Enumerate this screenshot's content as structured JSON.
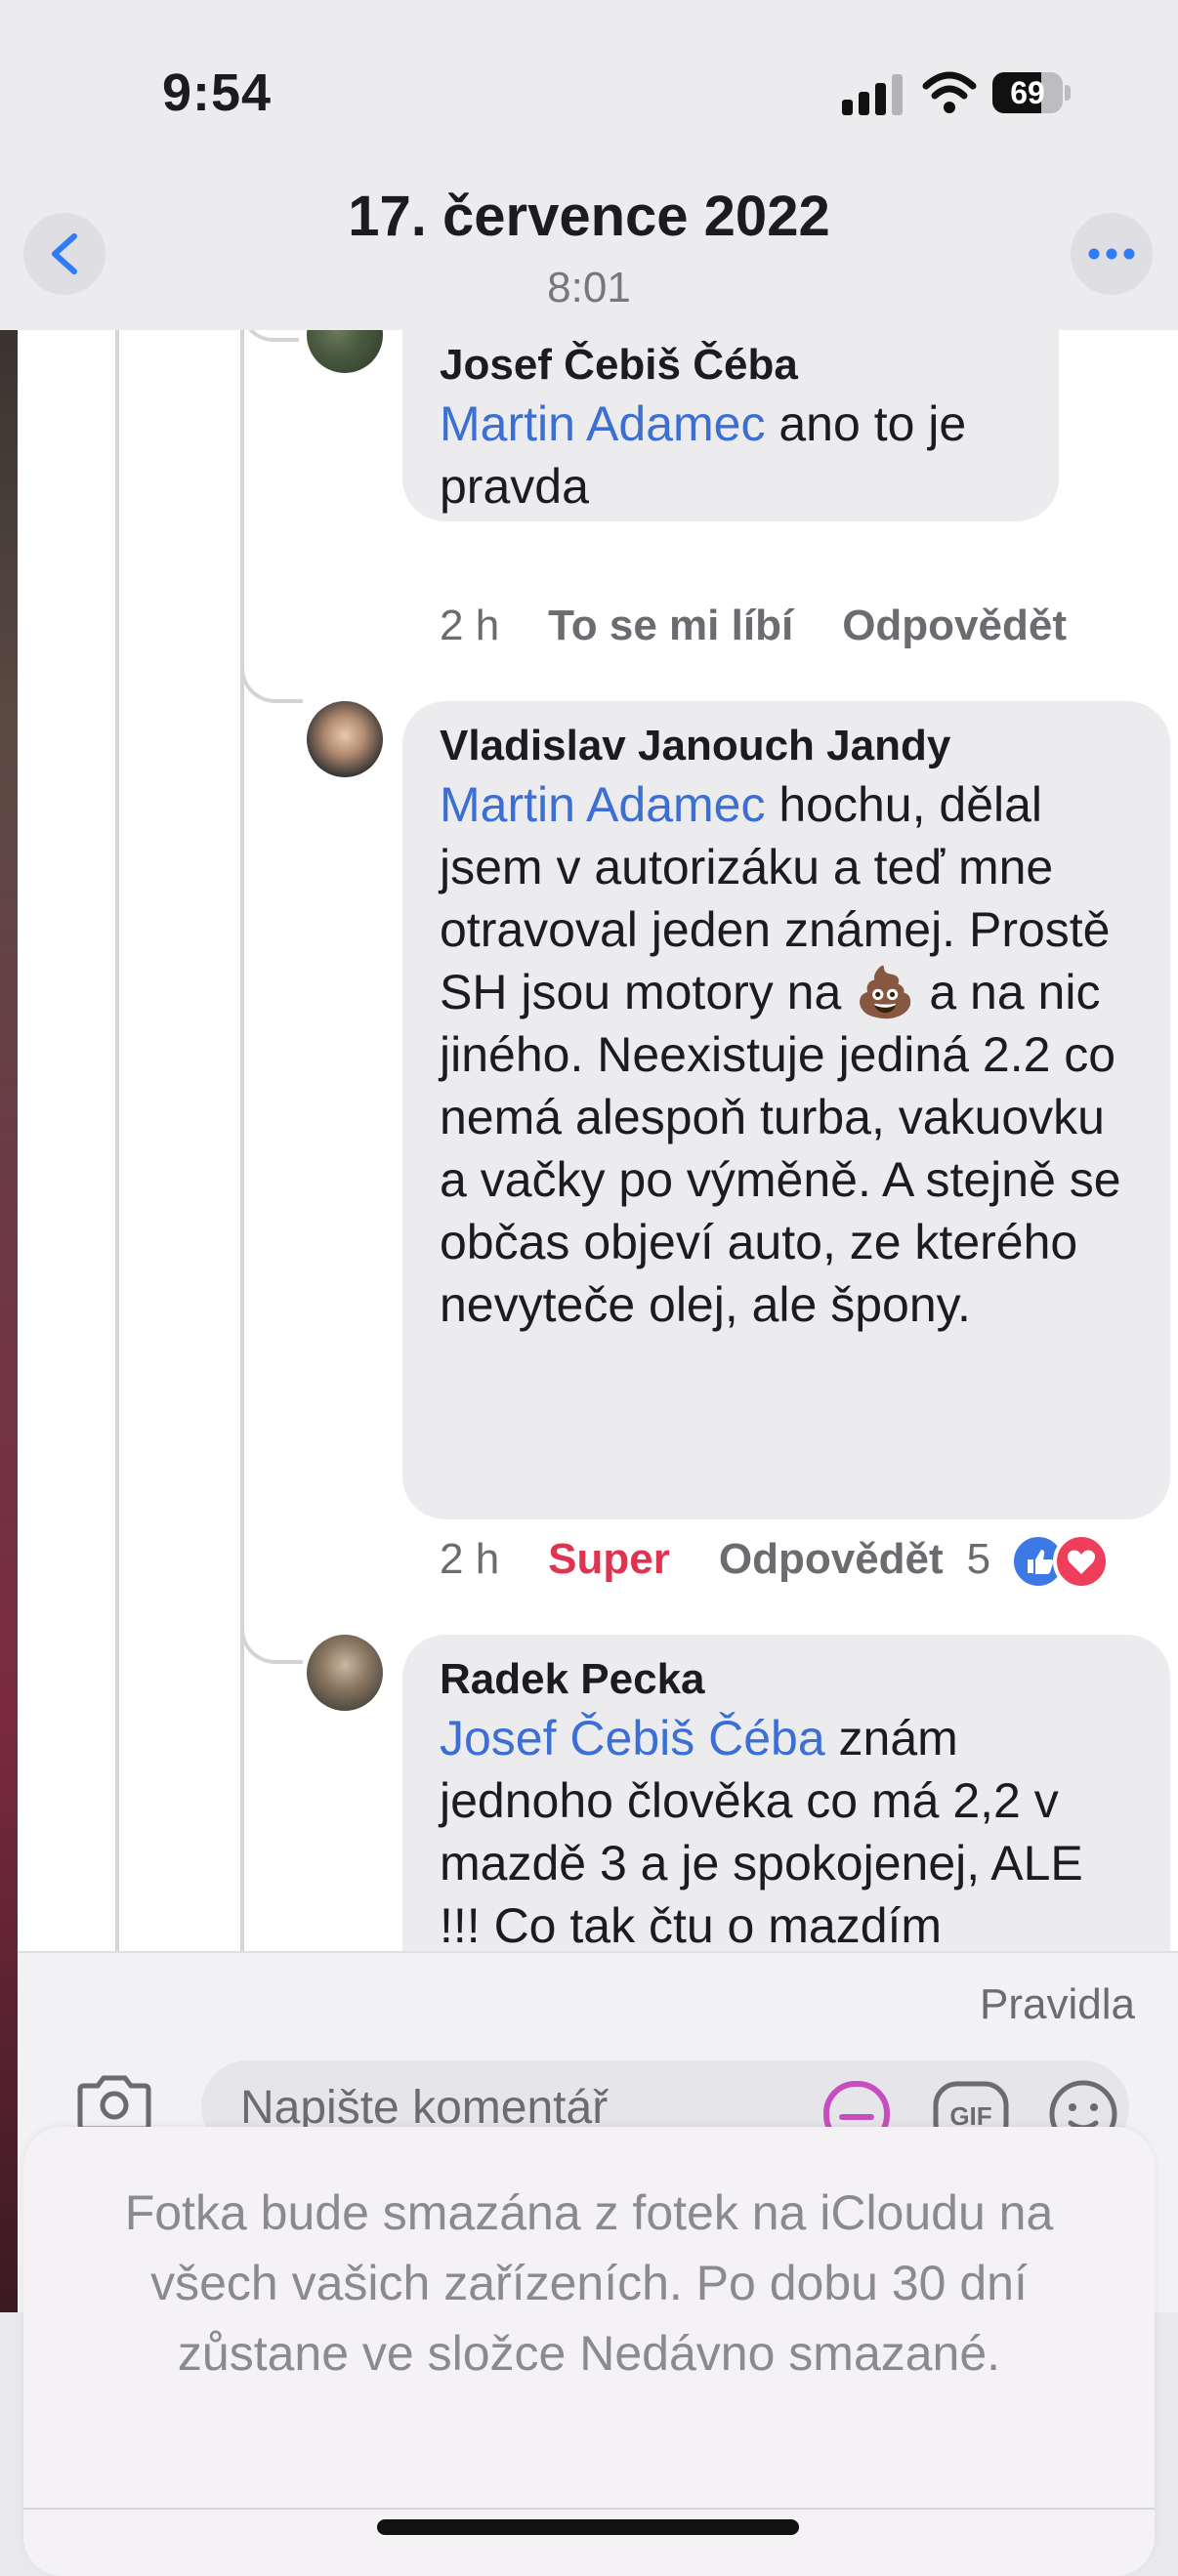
{
  "status_bar": {
    "time": "9:54",
    "battery": "69",
    "battery_level": 0.69
  },
  "header": {
    "title": "17. července 2022",
    "subtitle": "8:01"
  },
  "comments": [
    {
      "author": "Josef Čebiš Čéba",
      "mention": "Martin Adamec",
      "text": " ano to je pravda",
      "time": "2 h",
      "action1": "To se mi líbí",
      "action2": "Odpovědět"
    },
    {
      "author": "Vladislav Janouch Jandy",
      "mention": "Martin Adamec",
      "text": " hochu, dělal jsem v autorizáku a teď mne otravoval jeden známej. Prostě SH jsou motory na 💩 a na nic jiného. Neexistuje jediná 2.2 co nemá alespoň turba, vakuovku a vačky po výměně. A stejně se občas objeví auto, ze kterého nevyteče olej, ale špony.",
      "time": "2 h",
      "action1": "Super",
      "action2": "Odpovědět",
      "reaction_count": "5"
    },
    {
      "author": "Radek Pecka",
      "mention": "Josef Čebiš Čéba",
      "text": " znám jednoho člověka co má 2,2 v mazdě 3 a je spokojenej, ALE !!! Co tak čtu o mazdím"
    }
  ],
  "composer": {
    "rules_label": "Pravidla",
    "placeholder": "Napište komentář"
  },
  "action_sheet": {
    "message": "Fotka bude smazána z fotek na iCloudu na všech vašich zařízeních. Po dobu 30 dní zůstane ve složce Nedávno smazané."
  },
  "colors": {
    "accent": "#3b6fd4",
    "super": "#e0334f",
    "like": "#3c78e6",
    "love": "#ef3e5c"
  },
  "icons": [
    "chevron-left-icon",
    "ellipsis-icon",
    "signal-icon",
    "wifi-icon",
    "camera-icon",
    "sticker-icon",
    "gif-icon",
    "emoji-icon",
    "like-icon",
    "heart-icon"
  ]
}
